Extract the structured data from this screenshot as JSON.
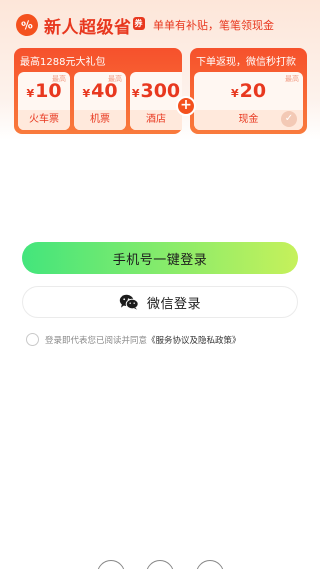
{
  "promo": {
    "logo_glyph": "%",
    "title": "新人超级省",
    "title_tag": "券",
    "subtitle": "单单有补贴，笔笔领现金",
    "left_caption": "最高1288元大礼包",
    "right_caption": "下单返现，微信秒打款",
    "currency": "¥",
    "corner_tag": "最高",
    "coupons": [
      {
        "amount": "10",
        "label": "火车票"
      },
      {
        "amount": "40",
        "label": "机票"
      },
      {
        "amount": "300",
        "label": "酒店"
      }
    ],
    "cash": {
      "amount": "20",
      "label": "现金"
    },
    "plus": "+"
  },
  "login": {
    "phone_button": "手机号一键登录",
    "wechat_button": "微信登录",
    "agreement_prefix": "登录即代表您已阅读并同意",
    "agreement_link": "《服务协议及隐私政策》"
  },
  "colors": {
    "brand_red": "#e8381f",
    "panel_orange": "#f6512c",
    "button_green_start": "#43e57c",
    "button_green_end": "#c6f15b"
  }
}
